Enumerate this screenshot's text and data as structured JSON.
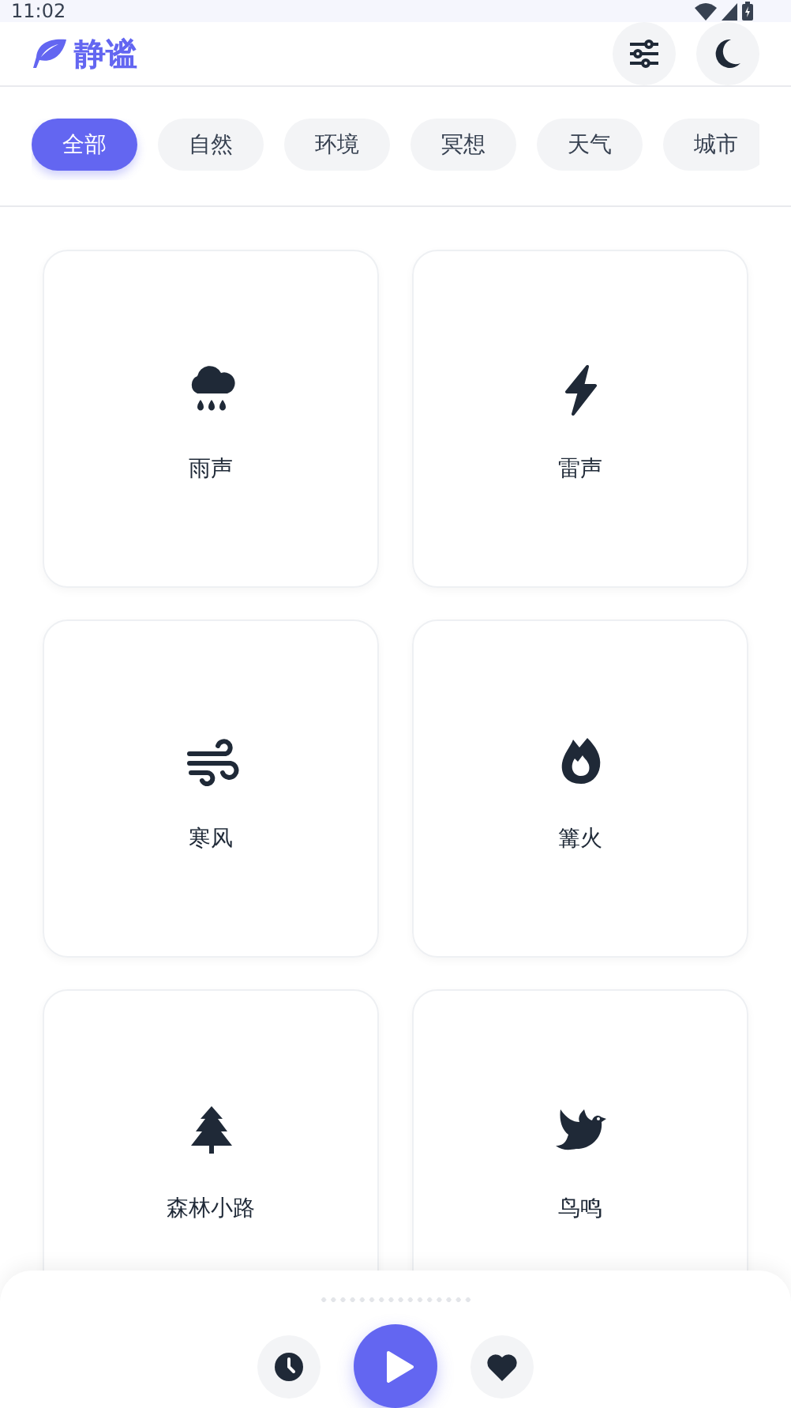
{
  "status_bar": {
    "time": "11:02"
  },
  "app": {
    "title": "静谧"
  },
  "categories": [
    {
      "label": "全部",
      "selected": true
    },
    {
      "label": "自然",
      "selected": false
    },
    {
      "label": "环境",
      "selected": false
    },
    {
      "label": "冥想",
      "selected": false
    },
    {
      "label": "天气",
      "selected": false
    },
    {
      "label": "城市",
      "selected": false
    }
  ],
  "sounds": [
    {
      "name": "雨声",
      "kind": "rain"
    },
    {
      "name": "雷声",
      "kind": "thunder"
    },
    {
      "name": "寒风",
      "kind": "wind"
    },
    {
      "name": "篝火",
      "kind": "fire"
    },
    {
      "name": "森林小路",
      "kind": "forest"
    },
    {
      "name": "鸟鸣",
      "kind": "bird"
    }
  ]
}
